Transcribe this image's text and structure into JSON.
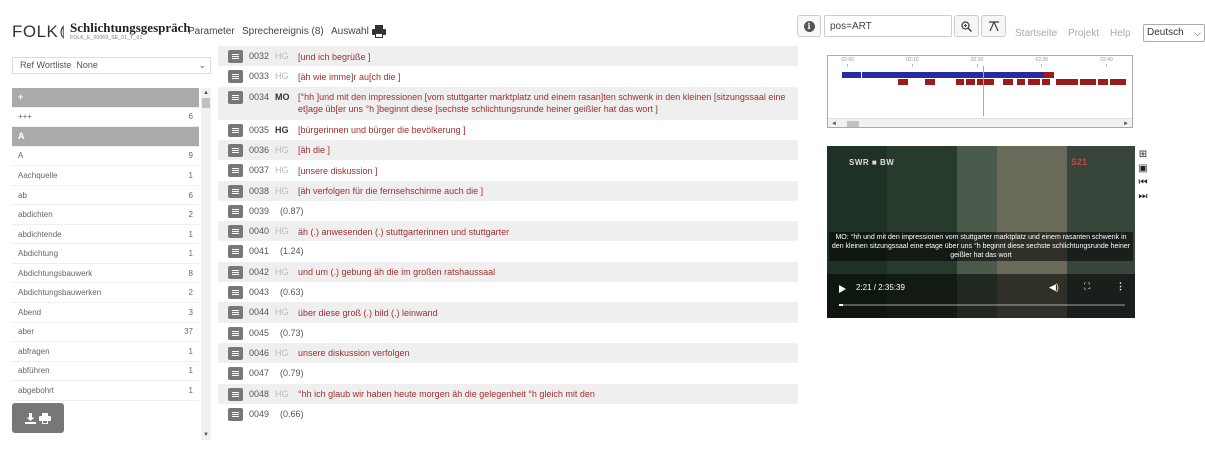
{
  "header": {
    "logo": "FOLK",
    "logo_wave": "⟬",
    "title": "Schlichtungsgespräch",
    "subtitle": "FOLK_E_00069_SE_01_T_01",
    "nav": [
      "Parameter",
      "Sprechereignis (8)",
      "Auswahl"
    ],
    "print_icon": "printer-icon",
    "search_value": "pos=ART",
    "links": [
      "Startseite",
      "Projekt",
      "Help"
    ],
    "language": "Deutsch",
    "chevron": "⌵"
  },
  "wordlist": {
    "ref_label": "Ref Wortliste",
    "ref_value": "None",
    "chevron": "⌄",
    "rows": [
      {
        "word": "+",
        "count": "",
        "header": true
      },
      {
        "word": "+++",
        "count": "6",
        "header": false
      },
      {
        "word": "A",
        "count": "",
        "header": true
      },
      {
        "word": "A",
        "count": "9",
        "header": false
      },
      {
        "word": "Aachquelle",
        "count": "1",
        "header": false
      },
      {
        "word": "ab",
        "count": "6",
        "header": false
      },
      {
        "word": "abdichten",
        "count": "2",
        "header": false
      },
      {
        "word": "abdichtende",
        "count": "1",
        "header": false
      },
      {
        "word": "Abdichtung",
        "count": "1",
        "header": false
      },
      {
        "word": "Abdichtungsbauwerk",
        "count": "8",
        "header": false
      },
      {
        "word": "Abdichtungsbauwerken",
        "count": "2",
        "header": false
      },
      {
        "word": "Abend",
        "count": "3",
        "header": false
      },
      {
        "word": "aber",
        "count": "37",
        "header": false
      },
      {
        "word": "abfragen",
        "count": "1",
        "header": false
      },
      {
        "word": "abführen",
        "count": "1",
        "header": false
      },
      {
        "word": "abgebohrt",
        "count": "1",
        "header": false
      }
    ],
    "scroll_up": "▲",
    "scroll_down": "▼",
    "download_icon": "download-icon",
    "print_icon": "printer-icon"
  },
  "transcript": {
    "segments": [
      {
        "num": "0032",
        "speaker": "HG",
        "bold": false,
        "text": "[und ich begrüße ]",
        "pause": ""
      },
      {
        "num": "0033",
        "speaker": "HG",
        "bold": false,
        "text": "[äh wie imme]r au[ch die ]",
        "pause": ""
      },
      {
        "num": "0034",
        "speaker": "MO",
        "bold": true,
        "text": "[°hh ]und mit den impressionen [vom stuttgarter marktplatz und einem rasan]ten schwenk in den kleinen [sitzungssaal eine et]age üb[er uns °h ]beginnt diese [sechste schlichtungsrunde heiner geißler hat das wort ]",
        "pause": ""
      },
      {
        "num": "0035",
        "speaker": "HG",
        "bold": true,
        "text": "[bürgerinnen und bürger die bevölkerung ]",
        "pause": ""
      },
      {
        "num": "0036",
        "speaker": "HG",
        "bold": false,
        "text": "[äh die ]",
        "pause": ""
      },
      {
        "num": "0037",
        "speaker": "HG",
        "bold": false,
        "text": "[unsere diskussion ]",
        "pause": ""
      },
      {
        "num": "0038",
        "speaker": "HG",
        "bold": false,
        "text": "[äh verfolgen für die fernsehschirme auch die ]",
        "pause": ""
      },
      {
        "num": "0039",
        "speaker": "",
        "bold": false,
        "text": "",
        "pause": "(0.87)"
      },
      {
        "num": "0040",
        "speaker": "HG",
        "bold": false,
        "text": "äh (.) anwesenden (.) stuttgarterinnen und stuttgarter",
        "pause": ""
      },
      {
        "num": "0041",
        "speaker": "",
        "bold": false,
        "text": "",
        "pause": "(1.24)"
      },
      {
        "num": "0042",
        "speaker": "HG",
        "bold": false,
        "text": "und um (.) gebung äh die im großen ratshaussaal",
        "pause": ""
      },
      {
        "num": "0043",
        "speaker": "",
        "bold": false,
        "text": "",
        "pause": "(0.63)"
      },
      {
        "num": "0044",
        "speaker": "HG",
        "bold": false,
        "text": "über diese groß (.) bild (.) leinwand",
        "pause": ""
      },
      {
        "num": "0045",
        "speaker": "",
        "bold": false,
        "text": "",
        "pause": "(0.73)"
      },
      {
        "num": "0046",
        "speaker": "HG",
        "bold": false,
        "text": "unsere diskussion verfolgen",
        "pause": ""
      },
      {
        "num": "0047",
        "speaker": "",
        "bold": false,
        "text": "",
        "pause": "(0.79)"
      },
      {
        "num": "0048",
        "speaker": "HG",
        "bold": false,
        "text": "°hh ich glaub wir haben heute morgen äh die gelegenheit °h gleich mit den",
        "pause": ""
      },
      {
        "num": "0049",
        "speaker": "",
        "bold": false,
        "text": "",
        "pause": "(0.66)"
      }
    ]
  },
  "timeline": {
    "ticks": [
      "02:00",
      "02:10",
      "02:20",
      "02:30",
      "02:40"
    ],
    "cursor_seconds": 141,
    "range_seconds": [
      117,
      164
    ],
    "scroll_left": "◄",
    "scroll_right": "►",
    "colors": {
      "speaker_1": "#2a2aa0",
      "speaker_2": "#9a1b1b"
    }
  },
  "video": {
    "channel": "SWR ■ BW",
    "brand": "S21",
    "subtitle": "MO: °hh und mit den impressionen vom stuttgarter marktplatz und einem rasanten schwenk in den kleinen sitzungssaal eine etage über uns °h beginnt diese sechste schlichtungsrunde heiner geißler hat das wort",
    "time": "2:21 / 2:35:39",
    "progress": 0.015,
    "volume_icon": "volume-icon",
    "volume_glyph": "◀)",
    "fullscreen_icon": "fullscreen-icon",
    "fullscreen_glyph": "⛶",
    "more_icon": "more-icon",
    "more_glyph": "⋮",
    "side_icons": [
      {
        "name": "add-icon",
        "glyph": "⊞"
      },
      {
        "name": "camera-icon",
        "glyph": "▣"
      },
      {
        "name": "step-back-icon",
        "glyph": "⏮"
      },
      {
        "name": "step-forward-icon",
        "glyph": "⏭"
      }
    ]
  }
}
